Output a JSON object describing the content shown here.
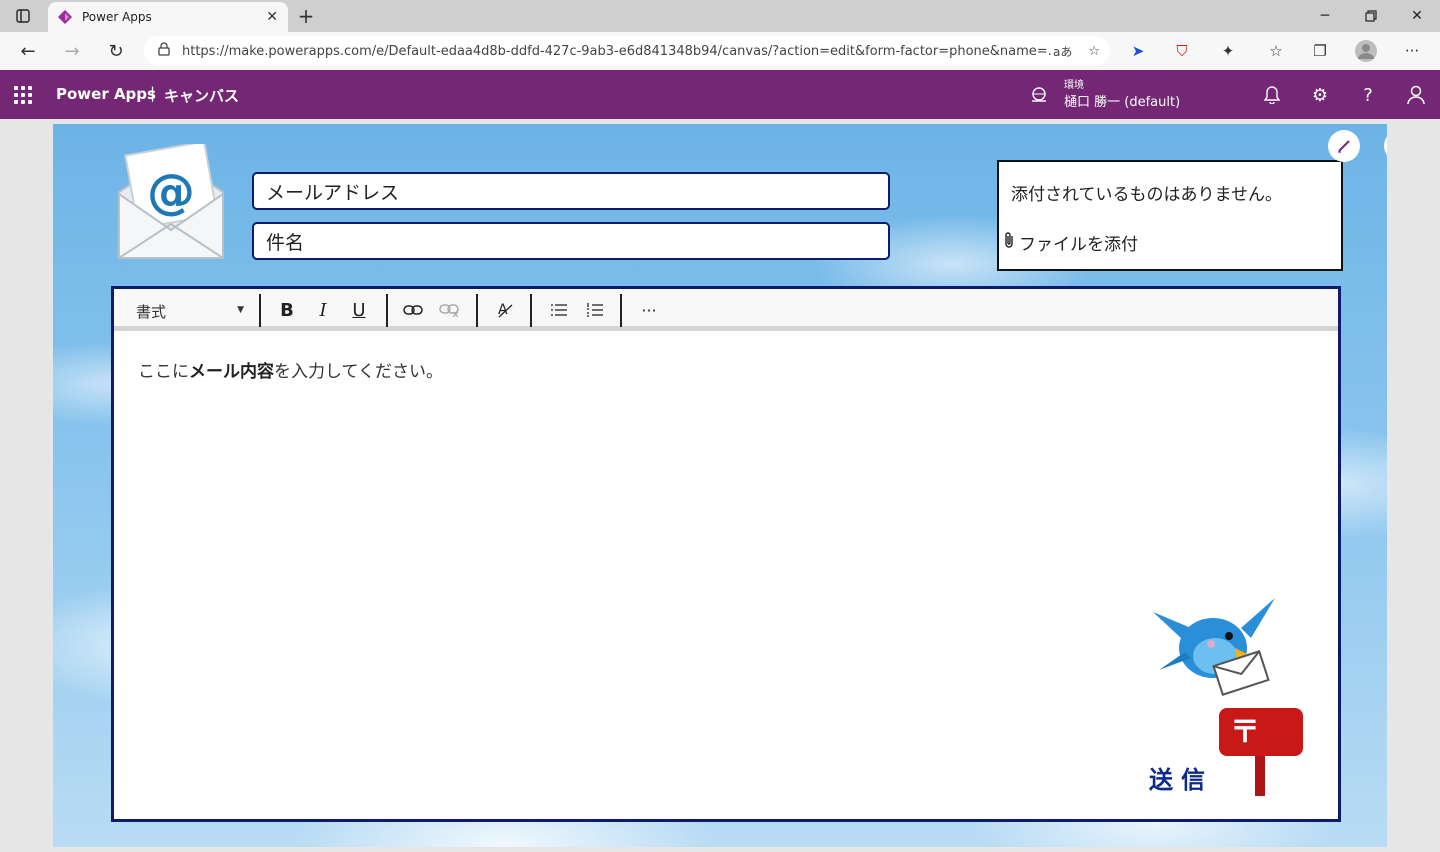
{
  "browser": {
    "tab_title": "Power Apps",
    "url": "https://make.powerapps.com/e/Default-edaa4d8b-ddfd-427c-9ab3-e6d841348b94/canvas/?action=edit&form-factor=phone&name=...",
    "reader_label": "aあ"
  },
  "header": {
    "app_name": "Power Apps",
    "separator": "|",
    "section": "キャンバス",
    "env_label": "環境",
    "env_name": "樋口 勝一 (default)"
  },
  "form": {
    "email_placeholder": "メールアドレス",
    "subject_placeholder": "件名",
    "attachments_empty": "添付されているものはありません。",
    "attach_file": "ファイルを添付",
    "send_label": "送信"
  },
  "editor": {
    "format_label": "書式",
    "body_prefix": "ここに",
    "body_bold": "メール内容",
    "body_suffix": "を入力してください。",
    "more_label": "···"
  },
  "colors": {
    "header_bg": "#742774",
    "field_border": "#0e1a6e",
    "send_text": "#0d2a8a"
  }
}
